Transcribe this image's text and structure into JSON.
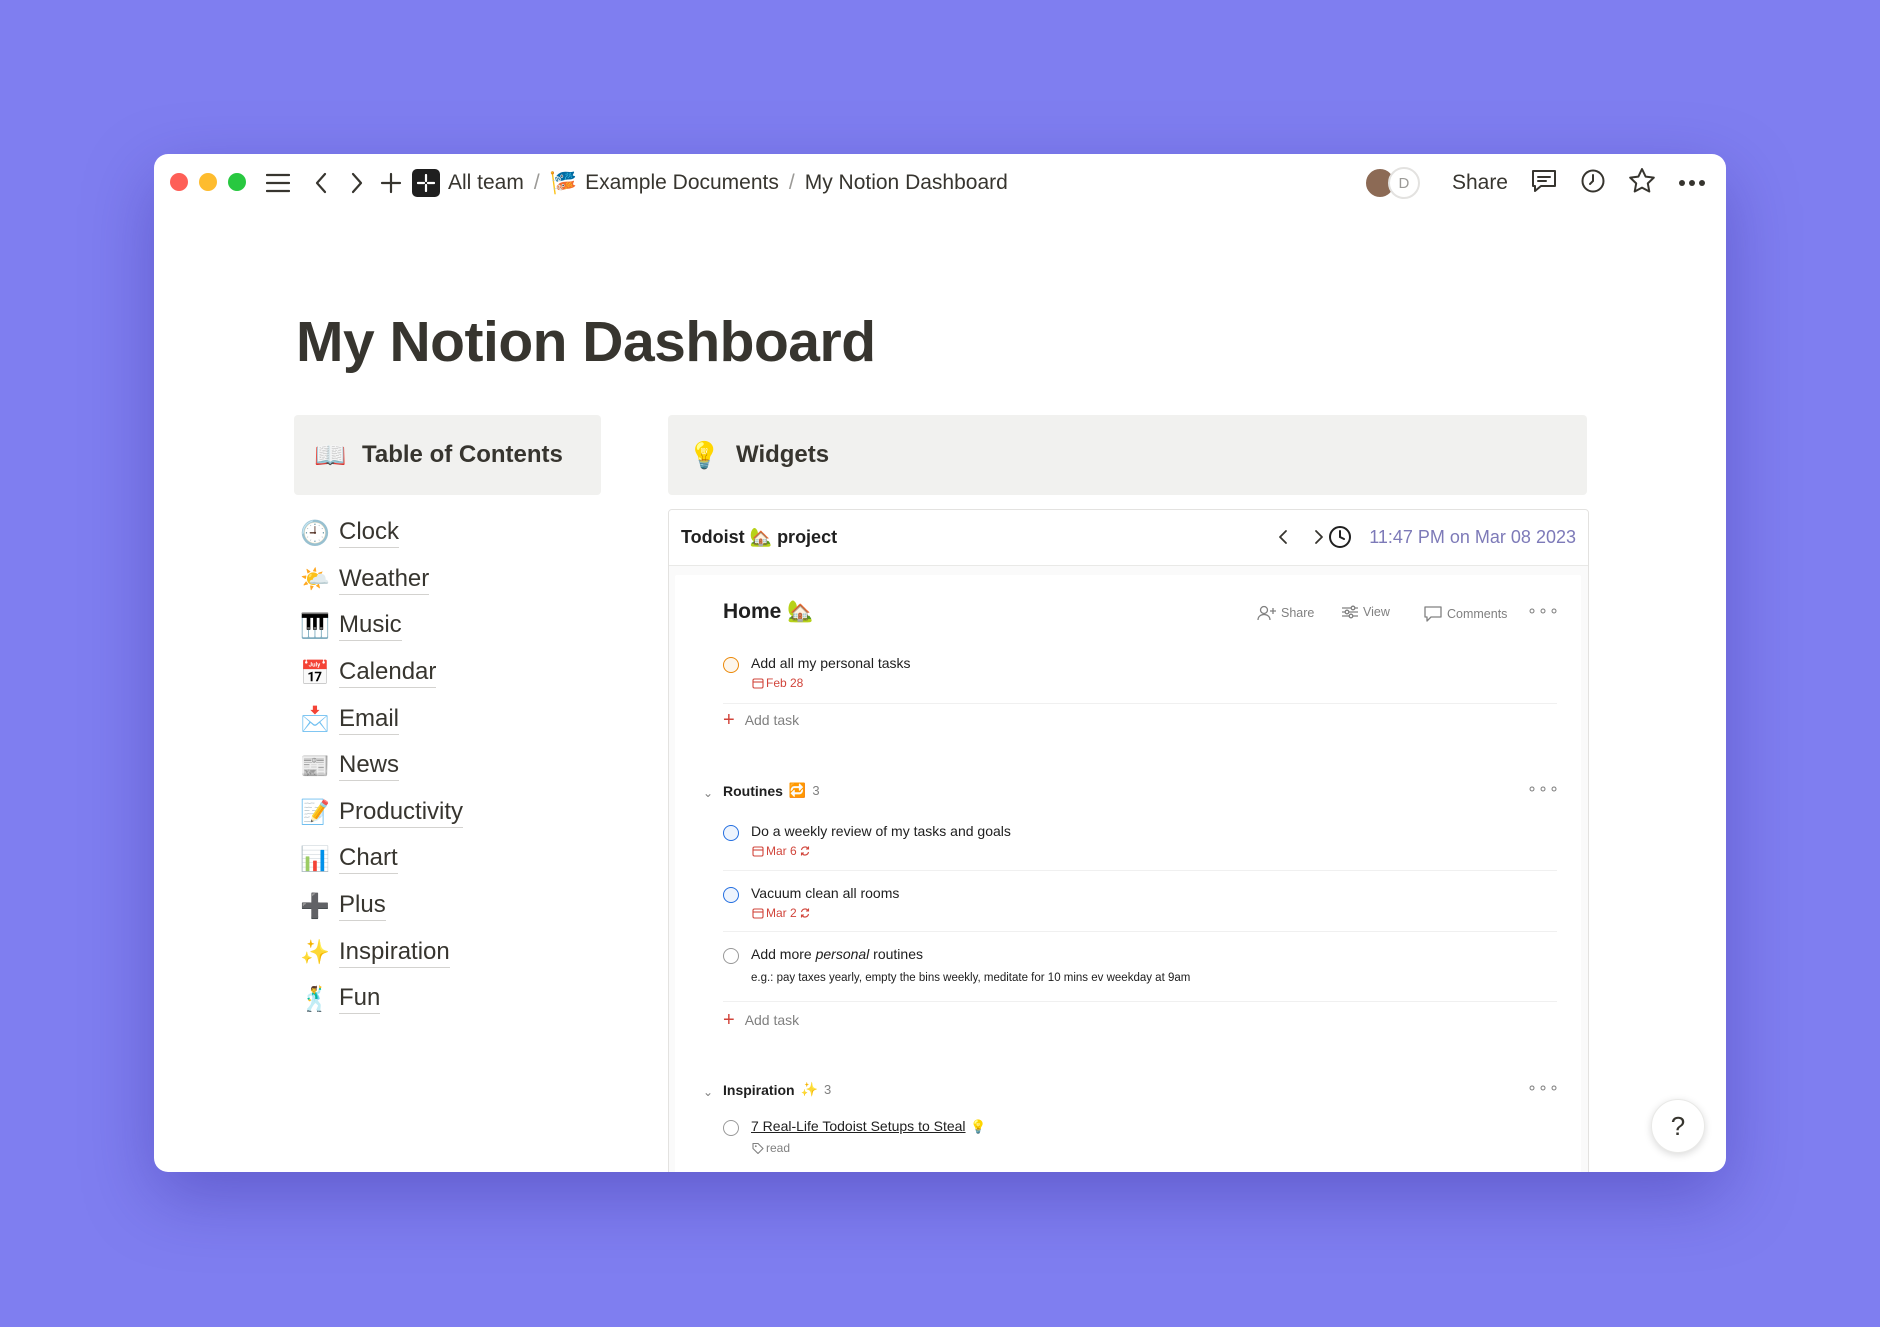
{
  "titlebar": {
    "breadcrumbs": [
      "All team",
      "Example Documents",
      "My Notion Dashboard"
    ],
    "separator": "/",
    "share_label": "Share",
    "avatar_initial": "D"
  },
  "page": {
    "title": "My Notion Dashboard"
  },
  "toc": {
    "title": "Table of Contents",
    "title_emoji": "📖",
    "items": [
      {
        "emoji": "🕘",
        "label": "Clock"
      },
      {
        "emoji": "🌤️",
        "label": "Weather"
      },
      {
        "emoji": "🎹",
        "label": "Music"
      },
      {
        "emoji": "📅",
        "label": "Calendar"
      },
      {
        "emoji": "📩",
        "label": "Email"
      },
      {
        "emoji": "📰",
        "label": "News"
      },
      {
        "emoji": "📝",
        "label": "Productivity"
      },
      {
        "emoji": "📊",
        "label": "Chart"
      },
      {
        "emoji": "➕",
        "label": "Plus"
      },
      {
        "emoji": "✨",
        "label": "Inspiration"
      },
      {
        "emoji": "🕺",
        "label": "Fun"
      }
    ]
  },
  "widgets": {
    "title": "Widgets",
    "title_emoji": "💡",
    "embed_title": "Todoist 🏡 project",
    "datetime": "11:47 PM on Mar 08 2023"
  },
  "todoist": {
    "project_title": "Home 🏡",
    "actions": {
      "share": "Share",
      "view": "View",
      "comments": "Comments"
    },
    "home_tasks": [
      {
        "text": "Add all my personal tasks",
        "date": "Feb 28"
      }
    ],
    "add_task_label": "Add task",
    "routines": {
      "name": "Routines",
      "emoji": "🔁",
      "count": "3",
      "tasks": [
        {
          "text": "Do a weekly review of my tasks and goals",
          "date": "Mar 6"
        },
        {
          "text": "Vacuum clean all rooms",
          "date": "Mar 2"
        },
        {
          "text_before": "Add more ",
          "text_em": "personal",
          "text_after": " routines",
          "description": "e.g.: pay taxes yearly, empty the bins weekly, meditate for 10 mins ev weekday at 9am"
        }
      ]
    },
    "inspiration": {
      "name": "Inspiration",
      "emoji": "✨",
      "count": "3",
      "tasks": [
        {
          "text": "7 Real-Life Todoist Setups to Steal",
          "emoji": "💡",
          "label": "read"
        }
      ]
    }
  },
  "help": {
    "label": "?"
  },
  "colors": {
    "background": "#7f7ef0",
    "text": "#37352f",
    "callout_bg": "#f1f1ef",
    "todoist_red": "#d1453b",
    "priority_orange": "#eb8909",
    "priority_blue": "#246fe0",
    "datetime": "#7d7ab8"
  }
}
